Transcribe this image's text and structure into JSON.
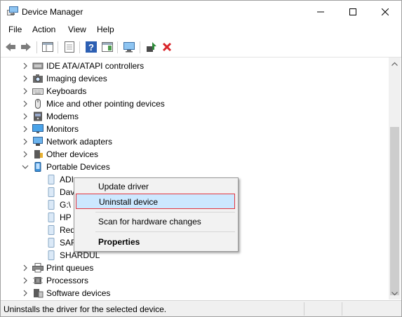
{
  "window": {
    "title": "Device Manager"
  },
  "menu": [
    "File",
    "Action",
    "View",
    "Help"
  ],
  "toolbar": {
    "buttons": [
      "back-icon",
      "forward-icon",
      "show-hide-tree-icon",
      "properties-icon",
      "help-icon",
      "action-pane-icon",
      "scan-hardware-icon",
      "update-driver-icon",
      "uninstall-icon"
    ]
  },
  "tree": {
    "items": [
      {
        "label": "IDE ATA/ATAPI controllers",
        "icon": "ide-controller-icon",
        "expanded": false
      },
      {
        "label": "Imaging devices",
        "icon": "camera-icon",
        "expanded": false
      },
      {
        "label": "Keyboards",
        "icon": "keyboard-icon",
        "expanded": false
      },
      {
        "label": "Mice and other pointing devices",
        "icon": "mouse-icon",
        "expanded": false
      },
      {
        "label": "Modems",
        "icon": "modem-icon",
        "expanded": false
      },
      {
        "label": "Monitors",
        "icon": "monitor-icon",
        "expanded": false
      },
      {
        "label": "Network adapters",
        "icon": "network-adapter-icon",
        "expanded": false
      },
      {
        "label": "Other devices",
        "icon": "unknown-device-icon",
        "expanded": false
      },
      {
        "label": "Portable Devices",
        "icon": "portable-device-icon",
        "expanded": true
      },
      {
        "label": "Print queues",
        "icon": "printer-icon",
        "expanded": false
      },
      {
        "label": "Processors",
        "icon": "processor-icon",
        "expanded": false
      },
      {
        "label": "Software devices",
        "icon": "software-device-icon",
        "expanded": false
      }
    ],
    "portable_children": [
      "ADI",
      "Dav",
      "G:\\",
      "HP",
      "Red",
      "SAR",
      "SHARDUL"
    ]
  },
  "context_menu": {
    "update_driver": "Update driver",
    "uninstall_device": "Uninstall device",
    "scan_hardware": "Scan for hardware changes",
    "properties": "Properties"
  },
  "status": {
    "text": "Uninstalls the driver for the selected device."
  },
  "colors": {
    "highlight": "#cce8ff",
    "highlight_border": "#e0353f",
    "uninstall_red": "#d9252a",
    "update_green": "#2e8b3a"
  }
}
